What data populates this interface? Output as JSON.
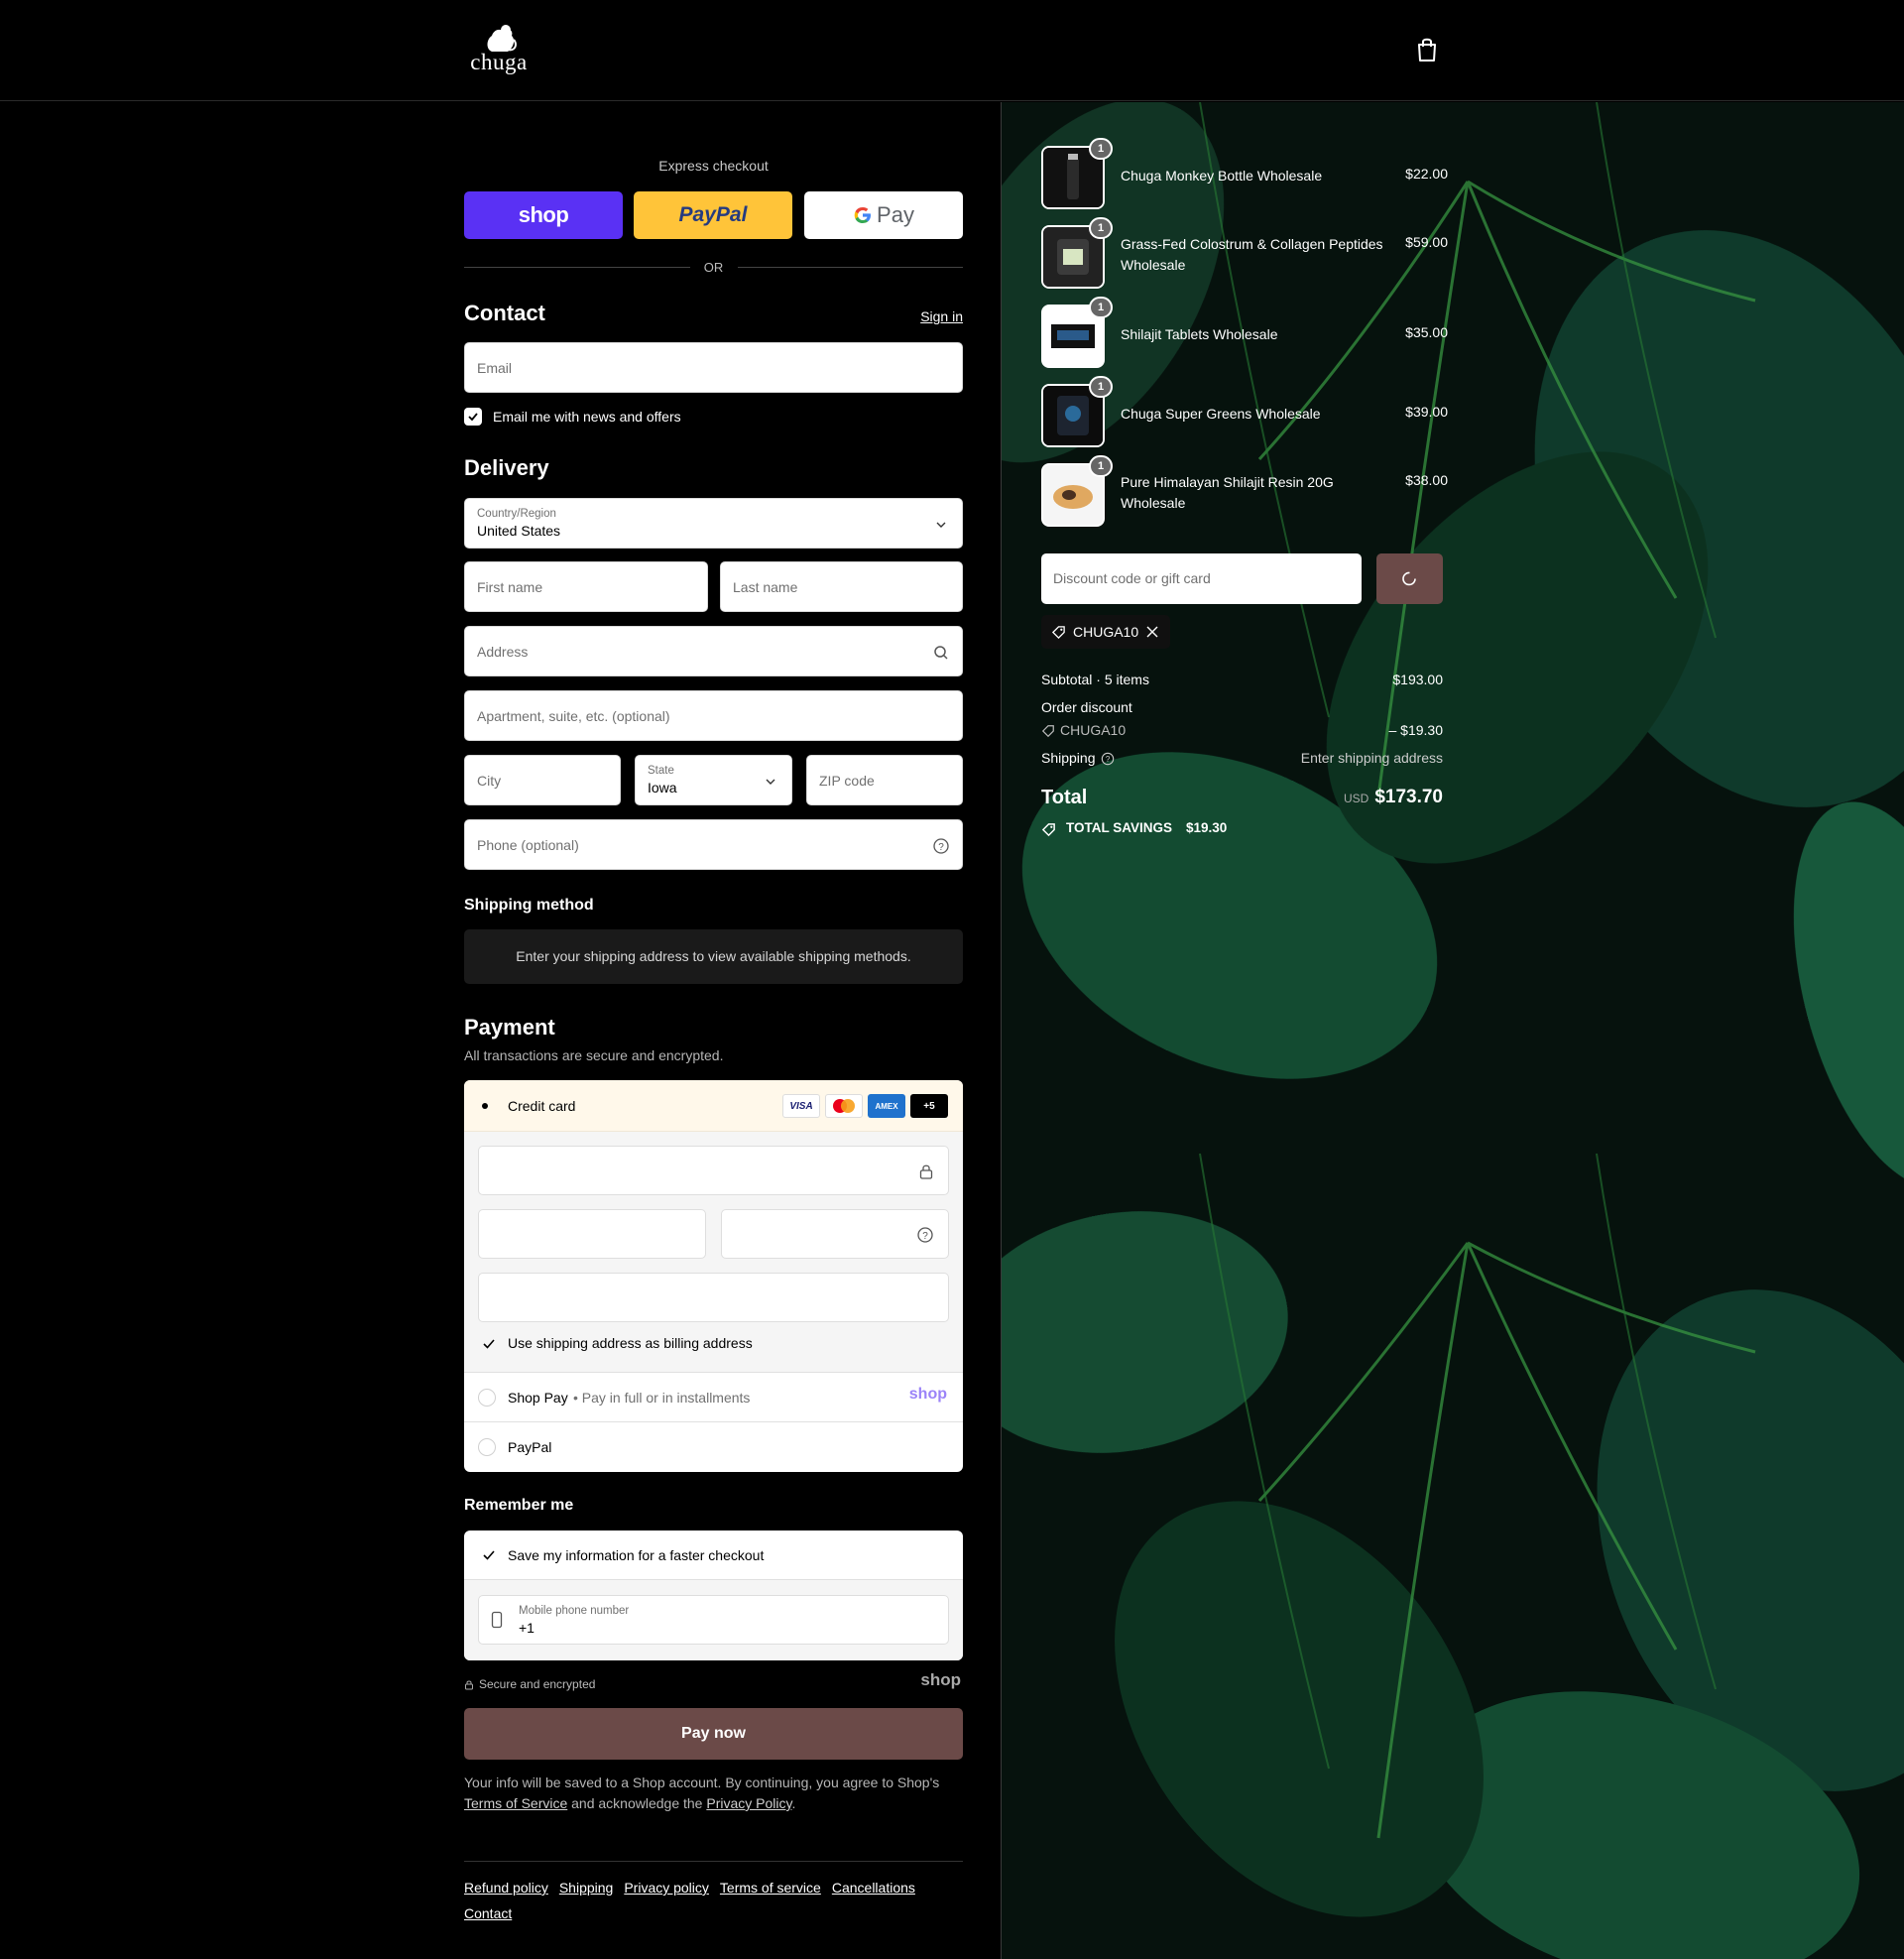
{
  "header": {
    "brand": "cһuga"
  },
  "express": {
    "title": "Express checkout",
    "shop_label": "shop",
    "paypal_label": "PayPal",
    "gpay_label": "Pay",
    "or_label": "OR"
  },
  "contact": {
    "title": "Contact",
    "sign_in": "Sign in",
    "email_placeholder": "Email",
    "news_label": "Email me with news and offers"
  },
  "delivery": {
    "title": "Delivery",
    "country_label": "Country/Region",
    "country_value": "United States",
    "first_name": "First name",
    "last_name": "Last name",
    "address": "Address",
    "apartment": "Apartment, suite, etc. (optional)",
    "city": "City",
    "state_label": "State",
    "state_value": "Iowa",
    "zip": "ZIP code",
    "phone": "Phone (optional)"
  },
  "shipping_method": {
    "title": "Shipping method",
    "message": "Enter your shipping address to view available shipping methods."
  },
  "payment": {
    "title": "Payment",
    "subtitle": "All transactions are secure and encrypted.",
    "credit_card": "Credit card",
    "brands": [
      "VISA",
      "",
      "AMEX",
      "+5"
    ],
    "billing_label": "Use shipping address as billing address",
    "shop_pay": "Shop Pay",
    "shop_pay_sub": "Pay in full or in installments",
    "shop_logo": "shop",
    "paypal": "PayPal"
  },
  "remember": {
    "title": "Remember me",
    "save_label": "Save my information for a faster checkout",
    "phone_label": "Mobile phone number",
    "phone_value": "+1",
    "secure": "Secure and encrypted",
    "shop_logo": "shop"
  },
  "pay_now": "Pay now",
  "legal": {
    "text1": "Your info will be saved to a Shop account. By continuing, you agree to Shop's ",
    "tos": "Terms of Service",
    "text2": " and acknowledge the ",
    "privacy": "Privacy Policy",
    "text3": "."
  },
  "footer_links": [
    "Refund policy",
    "Shipping",
    "Privacy policy",
    "Terms of service",
    "Cancellations",
    "Contact"
  ],
  "order": {
    "items": [
      {
        "qty": "1",
        "name": "Chuga Monkey Bottle Wholesale",
        "price": "$22.00"
      },
      {
        "qty": "1",
        "name": "Grass-Fed Colostrum & Collagen Peptides Wholesale",
        "price": "$59.00"
      },
      {
        "qty": "1",
        "name": "Shilajit Tablets Wholesale",
        "price": "$35.00"
      },
      {
        "qty": "1",
        "name": "Chuga Super Greens Wholesale",
        "price": "$39.00"
      },
      {
        "qty": "1",
        "name": "Pure Himalayan Shilajit Resin 20G Wholesale",
        "price": "$38.00"
      }
    ],
    "discount_placeholder": "Discount code or gift card",
    "applied_code": "CHUGA10",
    "subtotal_label": "Subtotal · 5 items",
    "subtotal_value": "$193.00",
    "order_discount_label": "Order discount",
    "discount_code": "CHUGA10",
    "discount_value": "– $19.30",
    "shipping_label": "Shipping",
    "shipping_value": "Enter shipping address",
    "total_label": "Total",
    "currency": "USD",
    "total_value": "$173.70",
    "savings_label": "TOTAL SAVINGS",
    "savings_value": "$19.30"
  },
  "colors": {
    "accent": "#6b4a48",
    "shop_purple": "#5a31f4",
    "paypal_yellow": "#ffc439"
  }
}
